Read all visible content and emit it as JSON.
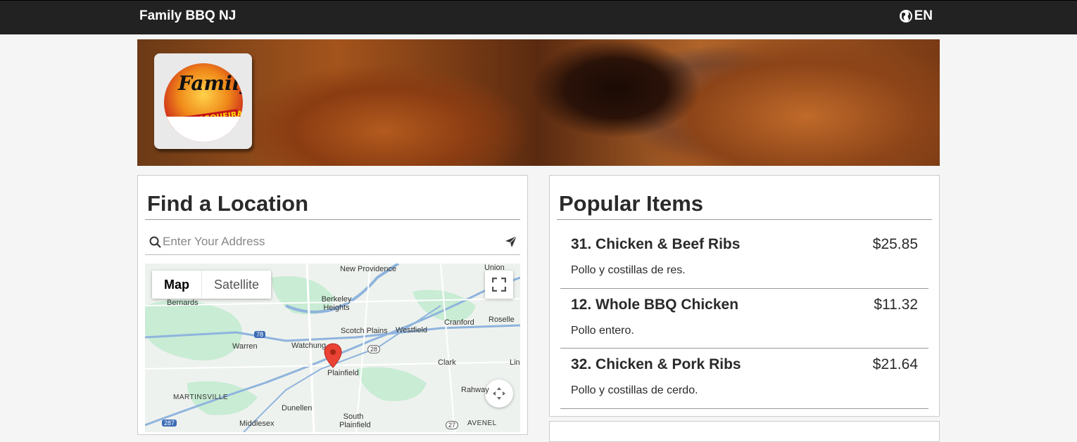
{
  "header": {
    "brand": "Family BBQ NJ",
    "language": "EN",
    "language_icon": "globe-icon"
  },
  "hero": {
    "logo_script": "Family",
    "logo_band": "CHURRASQUEIRA"
  },
  "location": {
    "title": "Find a Location",
    "search_placeholder": "Enter Your Address",
    "search_value": "",
    "map": {
      "toggle_map": "Map",
      "toggle_satellite": "Satellite",
      "labels": [
        "New Providence",
        "Union",
        "Bernards",
        "Berkeley Heights",
        "Scotch Plains",
        "Westfield",
        "Cranford",
        "Roselle",
        "Warren",
        "Watchung",
        "Clark",
        "Linden",
        "Plainfield",
        "Rahway",
        "MARTINSVILLE",
        "Dunellen",
        "South Plainfield",
        "Middlesex",
        "AVENEL",
        "78",
        "28",
        "287",
        "27"
      ]
    }
  },
  "popular": {
    "title": "Popular Items",
    "items": [
      {
        "name": "31. Chicken & Beef Ribs",
        "price": "$25.85",
        "description": "Pollo y costillas de res."
      },
      {
        "name": "12. Whole BBQ Chicken",
        "price": "$11.32",
        "description": "Pollo entero."
      },
      {
        "name": "32. Chicken & Pork Ribs",
        "price": "$21.64",
        "description": "Pollo y costillas de cerdo."
      }
    ]
  }
}
